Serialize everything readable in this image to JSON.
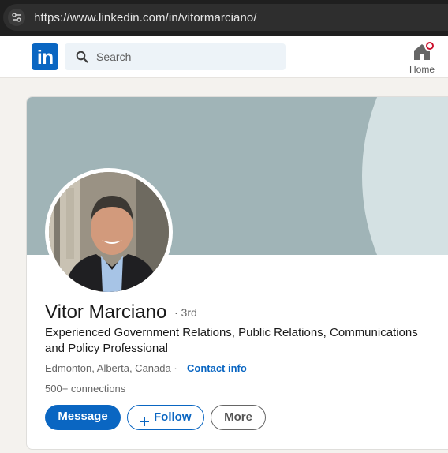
{
  "browser": {
    "url": "https://www.linkedin.com/in/vitormarciano/"
  },
  "nav": {
    "logo_text": "in",
    "search_placeholder": "Search",
    "home_label": "Home"
  },
  "profile": {
    "name": "Vitor Marciano",
    "degree": "· 3rd",
    "headline": "Experienced Government Relations, Public Relations, Communications and Policy Professional",
    "location": "Edmonton, Alberta, Canada ·",
    "contact_info": "Contact info",
    "connections": "500+ connections",
    "buttons": {
      "message": "Message",
      "follow": "Follow",
      "more": "More"
    }
  },
  "colors": {
    "brand": "#0a66c2",
    "cover": "#a0b4b7",
    "notification": "#cb112d"
  },
  "icons": [
    "site-settings-icon",
    "search-icon",
    "home-icon",
    "plus-icon"
  ]
}
